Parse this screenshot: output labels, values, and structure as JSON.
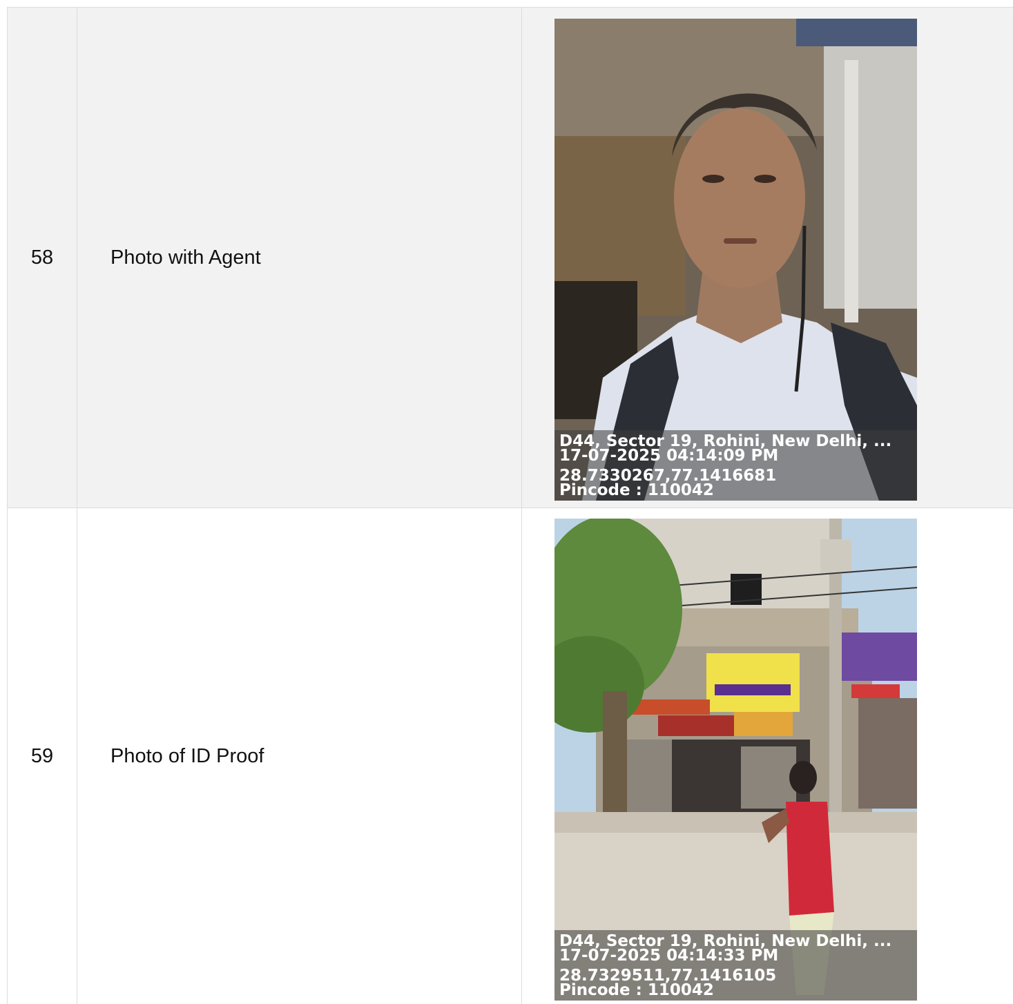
{
  "rows": [
    {
      "number": "58",
      "label": "Photo with Agent",
      "photo": {
        "subject": "agent-selfie",
        "stamp": {
          "address": "D44, Sector 19, Rohini, New Delhi, ...",
          "datetime": "17-07-2025 04:14:09 PM",
          "coordinates": "28.7330267,77.1416681",
          "pincode": "Pincode : 110042"
        }
      }
    },
    {
      "number": "59",
      "label": "Photo of ID Proof",
      "photo": {
        "subject": "street-shopfront",
        "stamp": {
          "address": "D44, Sector 19, Rohini, New Delhi, ...",
          "datetime": "17-07-2025 04:14:33 PM",
          "coordinates": "28.7329511,77.1416105",
          "pincode": "Pincode : 110042"
        }
      }
    }
  ]
}
